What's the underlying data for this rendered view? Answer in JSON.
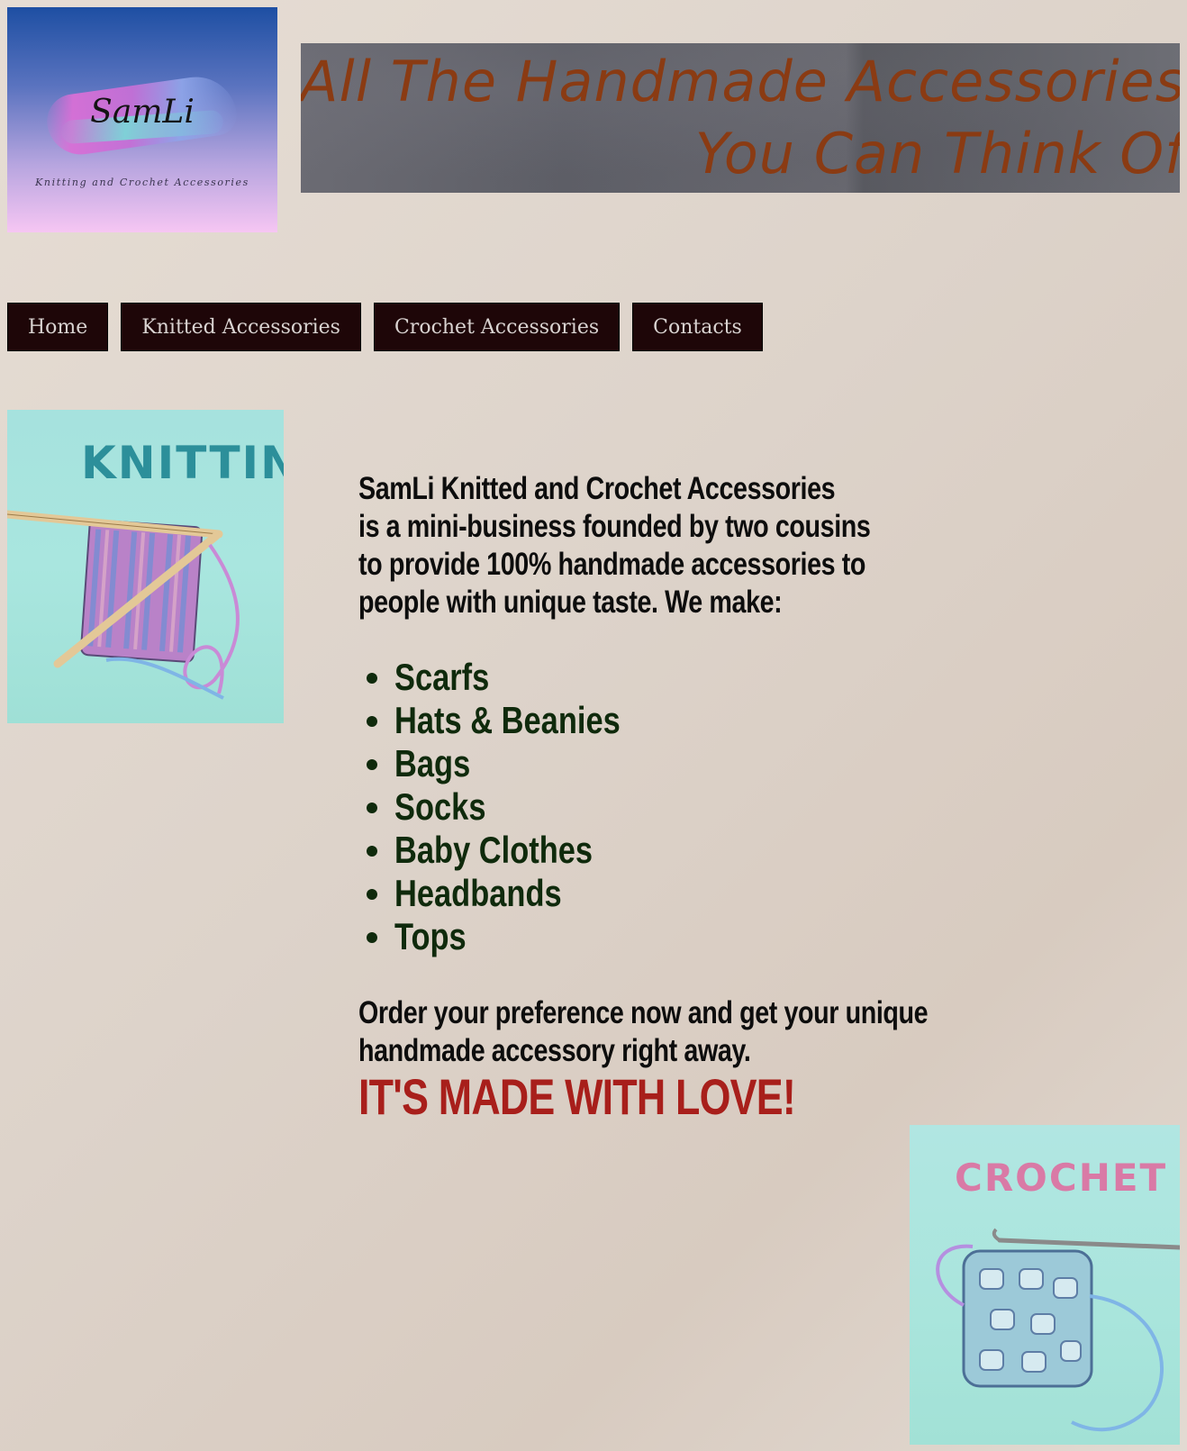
{
  "logo": {
    "name": "SamLi",
    "tagline": "Knitting and Crochet Accessories"
  },
  "banner": {
    "line1": "All The Handmade Accessories",
    "line2": "You Can Think Of"
  },
  "nav": {
    "items": [
      {
        "label": "Home"
      },
      {
        "label": "Knitted Accessories"
      },
      {
        "label": "Crochet Accessories"
      },
      {
        "label": "Contacts"
      }
    ]
  },
  "images": {
    "knitting_title": "KNITTING",
    "crochet_title": "CROCHET"
  },
  "intro": {
    "lines": [
      "SamLi Knitted and Crochet Accessories",
      "is a mini-business founded by two cousins",
      "to provide 100% handmade accessories to",
      "people with unique taste. We make:"
    ]
  },
  "products": [
    "Scarfs",
    "Hats & Beanies",
    "Bags",
    "Socks",
    "Baby Clothes",
    "Headbands",
    "Tops"
  ],
  "order": {
    "lines": [
      "Order your preference now and get your unique",
      "handmade accessory right away."
    ]
  },
  "tagline": "IT'S MADE WITH LOVE!",
  "colors": {
    "nav_bg": "#1e0608",
    "banner_text": "#8a3b13",
    "products_text": "#0f2a0c",
    "love_text": "#a81f1b"
  }
}
